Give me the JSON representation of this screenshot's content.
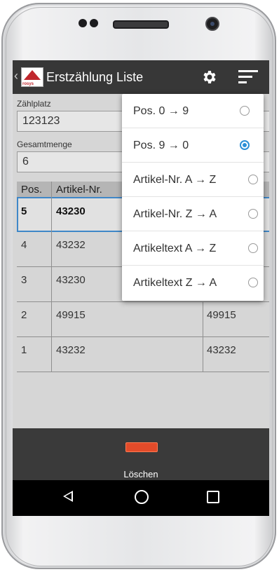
{
  "app_bar": {
    "title": "Erstzählung Liste",
    "logo_text": "rosys",
    "icons": {
      "settings": "gear-icon",
      "sort": "sort-icon"
    }
  },
  "fields": {
    "zaehlplatz": {
      "label": "Zählplatz",
      "value": "123123"
    },
    "gesamtmenge": {
      "label": "Gesamtmenge",
      "value": "6"
    }
  },
  "table": {
    "columns": [
      "Pos.",
      "Artikel-Nr."
    ],
    "rows": [
      {
        "pos": "5",
        "artikel_nr": "43230",
        "extra": ""
      },
      {
        "pos": "4",
        "artikel_nr": "43232",
        "extra": ""
      },
      {
        "pos": "3",
        "artikel_nr": "43230",
        "extra": ""
      },
      {
        "pos": "2",
        "artikel_nr": "49915",
        "extra": "49915"
      },
      {
        "pos": "1",
        "artikel_nr": "43232",
        "extra": "43232"
      }
    ]
  },
  "bottom_bar": {
    "delete_label": "Löschen"
  },
  "sort_menu": {
    "items": [
      {
        "label": "Pos. 0 → 9",
        "checked": false
      },
      {
        "label": "Pos. 9 → 0",
        "checked": true
      },
      {
        "label": "Artikel-Nr. A → Z",
        "checked": false
      },
      {
        "label": "Artikel-Nr. Z → A",
        "checked": false
      },
      {
        "label": "Artikeltext A → Z",
        "checked": false
      },
      {
        "label": "Artikeltext Z → A",
        "checked": false
      }
    ]
  },
  "colors": {
    "app_bar": "#373737",
    "accent_radio": "#2b8fd6",
    "selected_row_border": "#3f87c8",
    "delete": "#e24b2a"
  }
}
